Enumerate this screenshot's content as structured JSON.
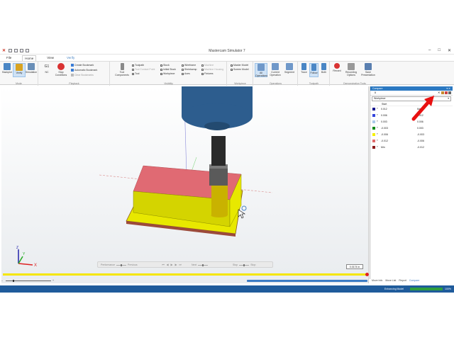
{
  "window": {
    "title": "Mastercam Simulator 7",
    "controls": [
      "–",
      "□",
      "✕"
    ]
  },
  "tabs": [
    {
      "label": "File"
    },
    {
      "label": "Home"
    },
    {
      "label": "View"
    },
    {
      "label": "Verify"
    }
  ],
  "ribbon": {
    "mode": {
      "label": "Mode",
      "buttons": [
        {
          "label": "Backplot"
        },
        {
          "label": "Verify"
        },
        {
          "label": "Simulation"
        }
      ]
    },
    "playback": {
      "label": "Playback",
      "g1": "G1",
      "nc": "NC",
      "stop": "Stop Conditions",
      "bookmark_create": "Create Bookmark",
      "bookmark_auto": "Automatic Bookmark",
      "bookmark_clear": "Clear Bookmarks"
    },
    "visibility": {
      "label": "Visibility",
      "tool_components": "Tool Components",
      "items": [
        {
          "label": "Toolpath",
          "checked": false,
          "disabled": false
        },
        {
          "label": "Tool Contact Point",
          "checked": false,
          "disabled": true
        },
        {
          "label": "Tool",
          "checked": true,
          "disabled": false
        },
        {
          "label": "Stock",
          "checked": true,
          "disabled": false
        },
        {
          "label": "Initial Stock",
          "checked": false,
          "disabled": false
        },
        {
          "label": "Workpiece",
          "checked": true,
          "disabled": false
        },
        {
          "label": "Wireframe",
          "checked": true,
          "disabled": false
        },
        {
          "label": "Shrinkwrap",
          "checked": false,
          "disabled": false
        },
        {
          "label": "Axes",
          "checked": true,
          "disabled": false
        },
        {
          "label": "Machine",
          "checked": false,
          "disabled": true
        },
        {
          "label": "Machine Housing",
          "checked": false,
          "disabled": true
        },
        {
          "label": "Fixtures",
          "checked": true,
          "disabled": false
        }
      ]
    },
    "workpiece": {
      "label": "Workpiece",
      "master_model": "Master Model",
      "screen_model": "Screen Model"
    },
    "operations": {
      "label": "Operations",
      "all": "All Operations",
      "current": "Current Operation",
      "segment": "Segment"
    },
    "toolpath": {
      "label": "Toolpath",
      "trace": "Trace",
      "follow": "Follow",
      "both": "Both"
    },
    "demo": {
      "label": "Demonstration Tools",
      "record": "Record",
      "recording_options": "Recording Options",
      "save": "Save Presentation"
    }
  },
  "playbar": {
    "left_label": "Performance",
    "prev_label": "Previous",
    "next_label": "Next",
    "stop_label": "Stop",
    "end_label": "Stop",
    "distance": "0.0174 in"
  },
  "progress_fraction": 1.0,
  "bottom_tabs": [
    "Move Info",
    "Move List",
    "Report",
    "Compare"
  ],
  "status": {
    "label": "Enhancing Model",
    "percent_text": "100%",
    "fraction": 1.0
  },
  "compare": {
    "title": "Compare",
    "count": "8",
    "dropdown": "Workpiece",
    "column_header": "Start",
    "rows": [
      {
        "color": "#1a1a8f",
        "a": "0.012",
        "b": "Max"
      },
      {
        "color": "#3344dd",
        "a": "0.006",
        "b": "0.012"
      },
      {
        "color": "#a9c8e8",
        "a": "0.003",
        "b": "0.006"
      },
      {
        "color": "#118a1a",
        "a": "-0.003",
        "b": "0.003"
      },
      {
        "color": "#f5f000",
        "a": "-0.006",
        "b": "-0.003"
      },
      {
        "color": "#e06a6a",
        "a": "-0.012",
        "b": "-0.006"
      },
      {
        "color": "#8b1a1a",
        "a": "Min",
        "b": "-0.012"
      }
    ]
  },
  "axes": {
    "x": "X",
    "y": "Y",
    "z": "Z"
  },
  "colors": {
    "accent": "#2b79c2",
    "stock_top": "#e06a73",
    "stock_side": "#e8e800",
    "tool_holder": "#2d5d8e",
    "arrow": "#e81010"
  }
}
